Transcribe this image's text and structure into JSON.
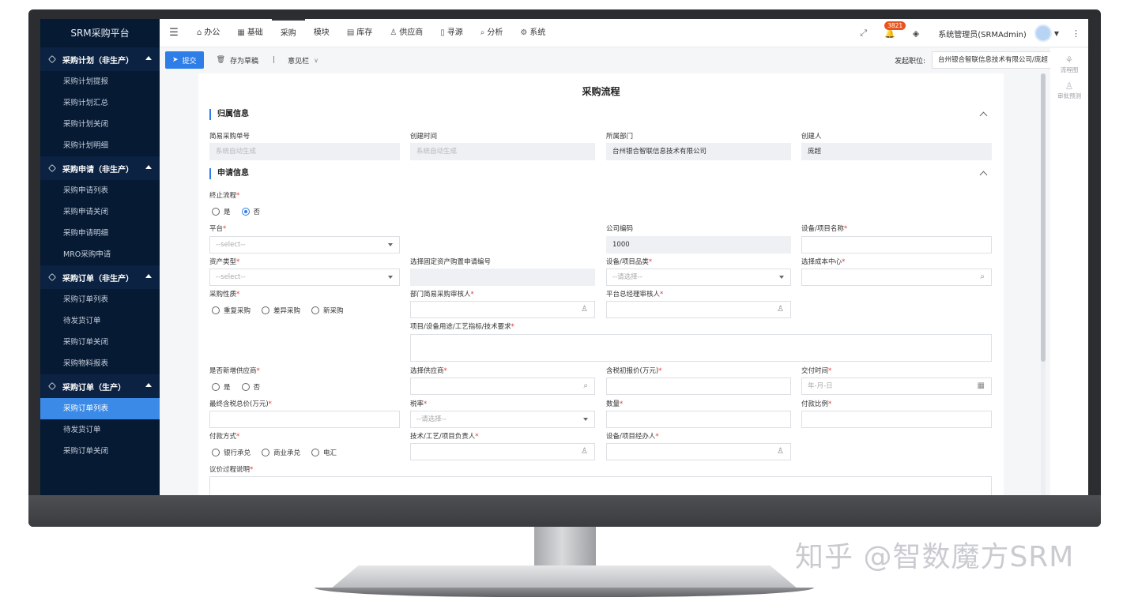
{
  "sidebar": {
    "brand": "SRM采购平台",
    "groups": [
      {
        "title": "采购计划（非生产）",
        "items": [
          "采购计划提报",
          "采购计划汇总",
          "采购计划关闭",
          "采购计划明细"
        ]
      },
      {
        "title": "采购申请（非生产）",
        "items": [
          "采购申请列表",
          "采购申请关闭",
          "采购申请明细",
          "MRO采购申请"
        ]
      },
      {
        "title": "采购订单（非生产）",
        "items": [
          "采购订单列表",
          "待发货订单",
          "采购订单关闭",
          "采购物料报表"
        ]
      },
      {
        "title": "采购订单（生产）",
        "items": [
          "采购订单列表",
          "待发货订单",
          "采购订单关闭"
        ]
      }
    ]
  },
  "topnav": {
    "items": [
      "办公",
      "基础",
      "采购",
      "模块",
      "库存",
      "供应商",
      "寻源",
      "分析",
      "系统"
    ],
    "active": "采购",
    "badge": "3821",
    "user": "系统管理员(SRMAdmin)"
  },
  "toolbar": {
    "submit": "提交",
    "draft": "存为草稿",
    "separator": "|",
    "opinion": "意见栏",
    "position_label": "发起职位:",
    "position_value": "台州银合智联信息技术有限公司/庞超"
  },
  "right_panel": {
    "flow": "流程图",
    "approval": "审批预测"
  },
  "form": {
    "title": "采购流程",
    "section1": "归属信息",
    "section2": "申请信息",
    "f_no_label": "简易采购单号",
    "f_no_value": "系统自动生成",
    "f_ctime_label": "创建时间",
    "f_ctime_value": "系统自动生成",
    "f_dept_label": "所属部门",
    "f_dept_value": "台州银合智联信息技术有限公司",
    "f_creator_label": "创建人",
    "f_creator_value": "庞超",
    "f_stop_label": "终止流程",
    "f_stop_yes": "是",
    "f_stop_no": "否",
    "f_platform_label": "平台",
    "f_platform_ph": "--select--",
    "f_company_label": "公司编码",
    "f_company_value": "1000",
    "f_project_label": "设备/项目名称",
    "f_asset_label": "资产类型",
    "f_asset_ph": "--select--",
    "f_fixed_label": "选择固定资产购置申请编号",
    "f_category_label": "设备/项目品类",
    "f_category_ph": "--请选择--",
    "f_cost_label": "选择成本中心",
    "f_nature_label": "采购性质",
    "f_nature_opts": [
      "重复采购",
      "差异采购",
      "新采购"
    ],
    "f_deptreviewer_label": "部门简易采购审核人",
    "f_gm_label": "平台总经理审核人",
    "f_purpose_label": "项目/设备用途/工艺指标/技术要求",
    "f_newsup_label": "是否新增供应商",
    "f_newsup_yes": "是",
    "f_newsup_no": "否",
    "f_supplier_label": "选择供应商",
    "f_initprice_label": "含税初报价(万元)",
    "f_delivery_label": "交付时间",
    "f_delivery_ph": "年-月-日",
    "f_finalprice_label": "最终含税总价(万元)",
    "f_tax_label": "税率",
    "f_tax_ph": "--请选择--",
    "f_qty_label": "数量",
    "f_payratio_label": "付款比例",
    "f_paymethod_label": "付款方式",
    "f_paymethod_opts": [
      "银行承兑",
      "商业承兑",
      "电汇"
    ],
    "f_tech_label": "技术/工艺/项目负责人",
    "f_handler_label": "设备/项目经办人",
    "f_negotiation_label": "议价过程说明",
    "required_mark": "*"
  },
  "watermark": "知乎 @智数魔方SRM",
  "colors": {
    "accent": "#2f7ee7",
    "sidebar_bg": "#061a34",
    "badge": "#e8561f"
  }
}
